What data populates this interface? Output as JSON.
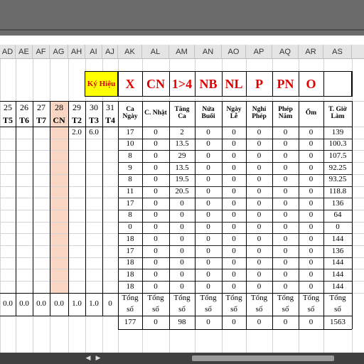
{
  "columns": [
    "AD",
    "AE",
    "AF",
    "AG",
    "AH",
    "AI",
    "AJ",
    "AK",
    "AL",
    "AM",
    "AN",
    "AO",
    "AP",
    "AQ",
    "AR",
    "AS"
  ],
  "legend": {
    "key_label": "Ký Hiệu",
    "symbols": [
      "X",
      "CN",
      "1>4",
      "NB",
      "NL",
      "P",
      "PN",
      "O"
    ]
  },
  "day_headers": {
    "numbers": [
      "25",
      "26",
      "27",
      "28",
      "29",
      "30",
      "31"
    ],
    "weekdays": [
      "T5",
      "T6",
      "T7",
      "CN",
      "T2",
      "T3",
      "T4"
    ]
  },
  "summary_headers": [
    "Ca Ngày",
    "C. Nhật",
    "Tăng Ca",
    "Nửa Buổi",
    "Ngày Lễ",
    "Nghỉ Phép",
    "Phép Năm",
    "Ốm",
    "T. Giờ Làm"
  ],
  "first_row_days": [
    "",
    "",
    "",
    "",
    "2.0",
    "6.0",
    ""
  ],
  "rows": [
    [
      "17",
      "0",
      "2",
      "0",
      "0",
      "0",
      "0",
      "0",
      "139"
    ],
    [
      "10",
      "0",
      "13.5",
      "0",
      "0",
      "0",
      "0",
      "0",
      "100.3"
    ],
    [
      "8",
      "0",
      "29",
      "0",
      "0",
      "0",
      "0",
      "0",
      "107.5"
    ],
    [
      "9",
      "0",
      "13.5",
      "0",
      "0",
      "0",
      "0",
      "0",
      "92.25"
    ],
    [
      "8",
      "0",
      "19.5",
      "0",
      "0",
      "0",
      "0",
      "0",
      "93.25"
    ],
    [
      "11",
      "0",
      "20.5",
      "0",
      "0",
      "0",
      "0",
      "0",
      "118.8"
    ],
    [
      "17",
      "0",
      "0",
      "0",
      "0",
      "0",
      "0",
      "0",
      "136"
    ],
    [
      "8",
      "0",
      "0",
      "0",
      "0",
      "0",
      "0",
      "0",
      "64"
    ],
    [
      "0",
      "0",
      "0",
      "0",
      "0",
      "0",
      "0",
      "0",
      "0"
    ],
    [
      "18",
      "0",
      "0",
      "0",
      "0",
      "0",
      "0",
      "0",
      "144"
    ],
    [
      "17",
      "0",
      "0",
      "0",
      "0",
      "0",
      "0",
      "0",
      "136"
    ],
    [
      "18",
      "0",
      "0",
      "0",
      "0",
      "0",
      "0",
      "0",
      "144"
    ],
    [
      "18",
      "0",
      "0",
      "0",
      "0",
      "0",
      "0",
      "0",
      "144"
    ],
    [
      "18",
      "0",
      "0",
      "0",
      "0",
      "0",
      "0",
      "0",
      "144"
    ]
  ],
  "totals_days": [
    "0.0",
    "0.0",
    "0.0",
    "0.0",
    "1.0",
    "1.0",
    "0"
  ],
  "totals_label_top": "Tổng",
  "totals_label_bottom": "số",
  "grand_totals": [
    "177",
    "0",
    "98",
    "0",
    "0",
    "0",
    "0",
    "0",
    "1563"
  ],
  "colors": {
    "cn_fill": "#f8d6c3",
    "legend_fill": "#ffff00",
    "legend_text": "#e00000"
  }
}
